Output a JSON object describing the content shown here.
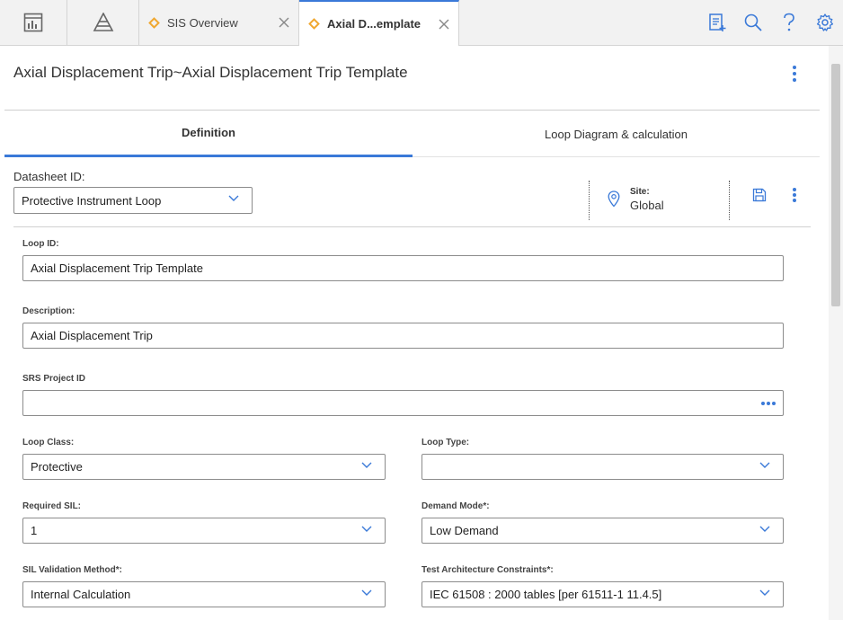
{
  "tabs": [
    {
      "label": "SIS Overview"
    },
    {
      "label": "Axial D...emplate"
    }
  ],
  "page_title": "Axial Displacement Trip~Axial Displacement Trip Template",
  "detail_tabs": [
    {
      "label": "Definition"
    },
    {
      "label": "Loop Diagram & calculation"
    }
  ],
  "datasheet": {
    "label": "Datasheet ID:",
    "value": "Protective Instrument Loop"
  },
  "site": {
    "label": "Site:",
    "value": "Global"
  },
  "fields": {
    "loop_id": {
      "label": "Loop ID:",
      "value": "Axial Displacement Trip Template"
    },
    "description": {
      "label": "Description:",
      "value": "Axial Displacement Trip"
    },
    "srs_project_id": {
      "label": "SRS Project ID",
      "value": ""
    },
    "loop_class": {
      "label": "Loop Class:",
      "value": "Protective"
    },
    "loop_type": {
      "label": "Loop Type:",
      "value": ""
    },
    "required_sil": {
      "label": "Required SIL:",
      "value": "1"
    },
    "demand_mode": {
      "label": "Demand Mode*:",
      "value": "Low Demand"
    },
    "sil_validation_method": {
      "label": "SIL Validation Method*:",
      "value": "Internal Calculation"
    },
    "test_architecture_constraints": {
      "label": "Test Architecture Constraints*:",
      "value": "IEC 61508 : 2000 tables [per 61511-1 11.4.5]"
    }
  },
  "colors": {
    "accent": "#3a79d8",
    "tab_icon": "#f0a830"
  }
}
